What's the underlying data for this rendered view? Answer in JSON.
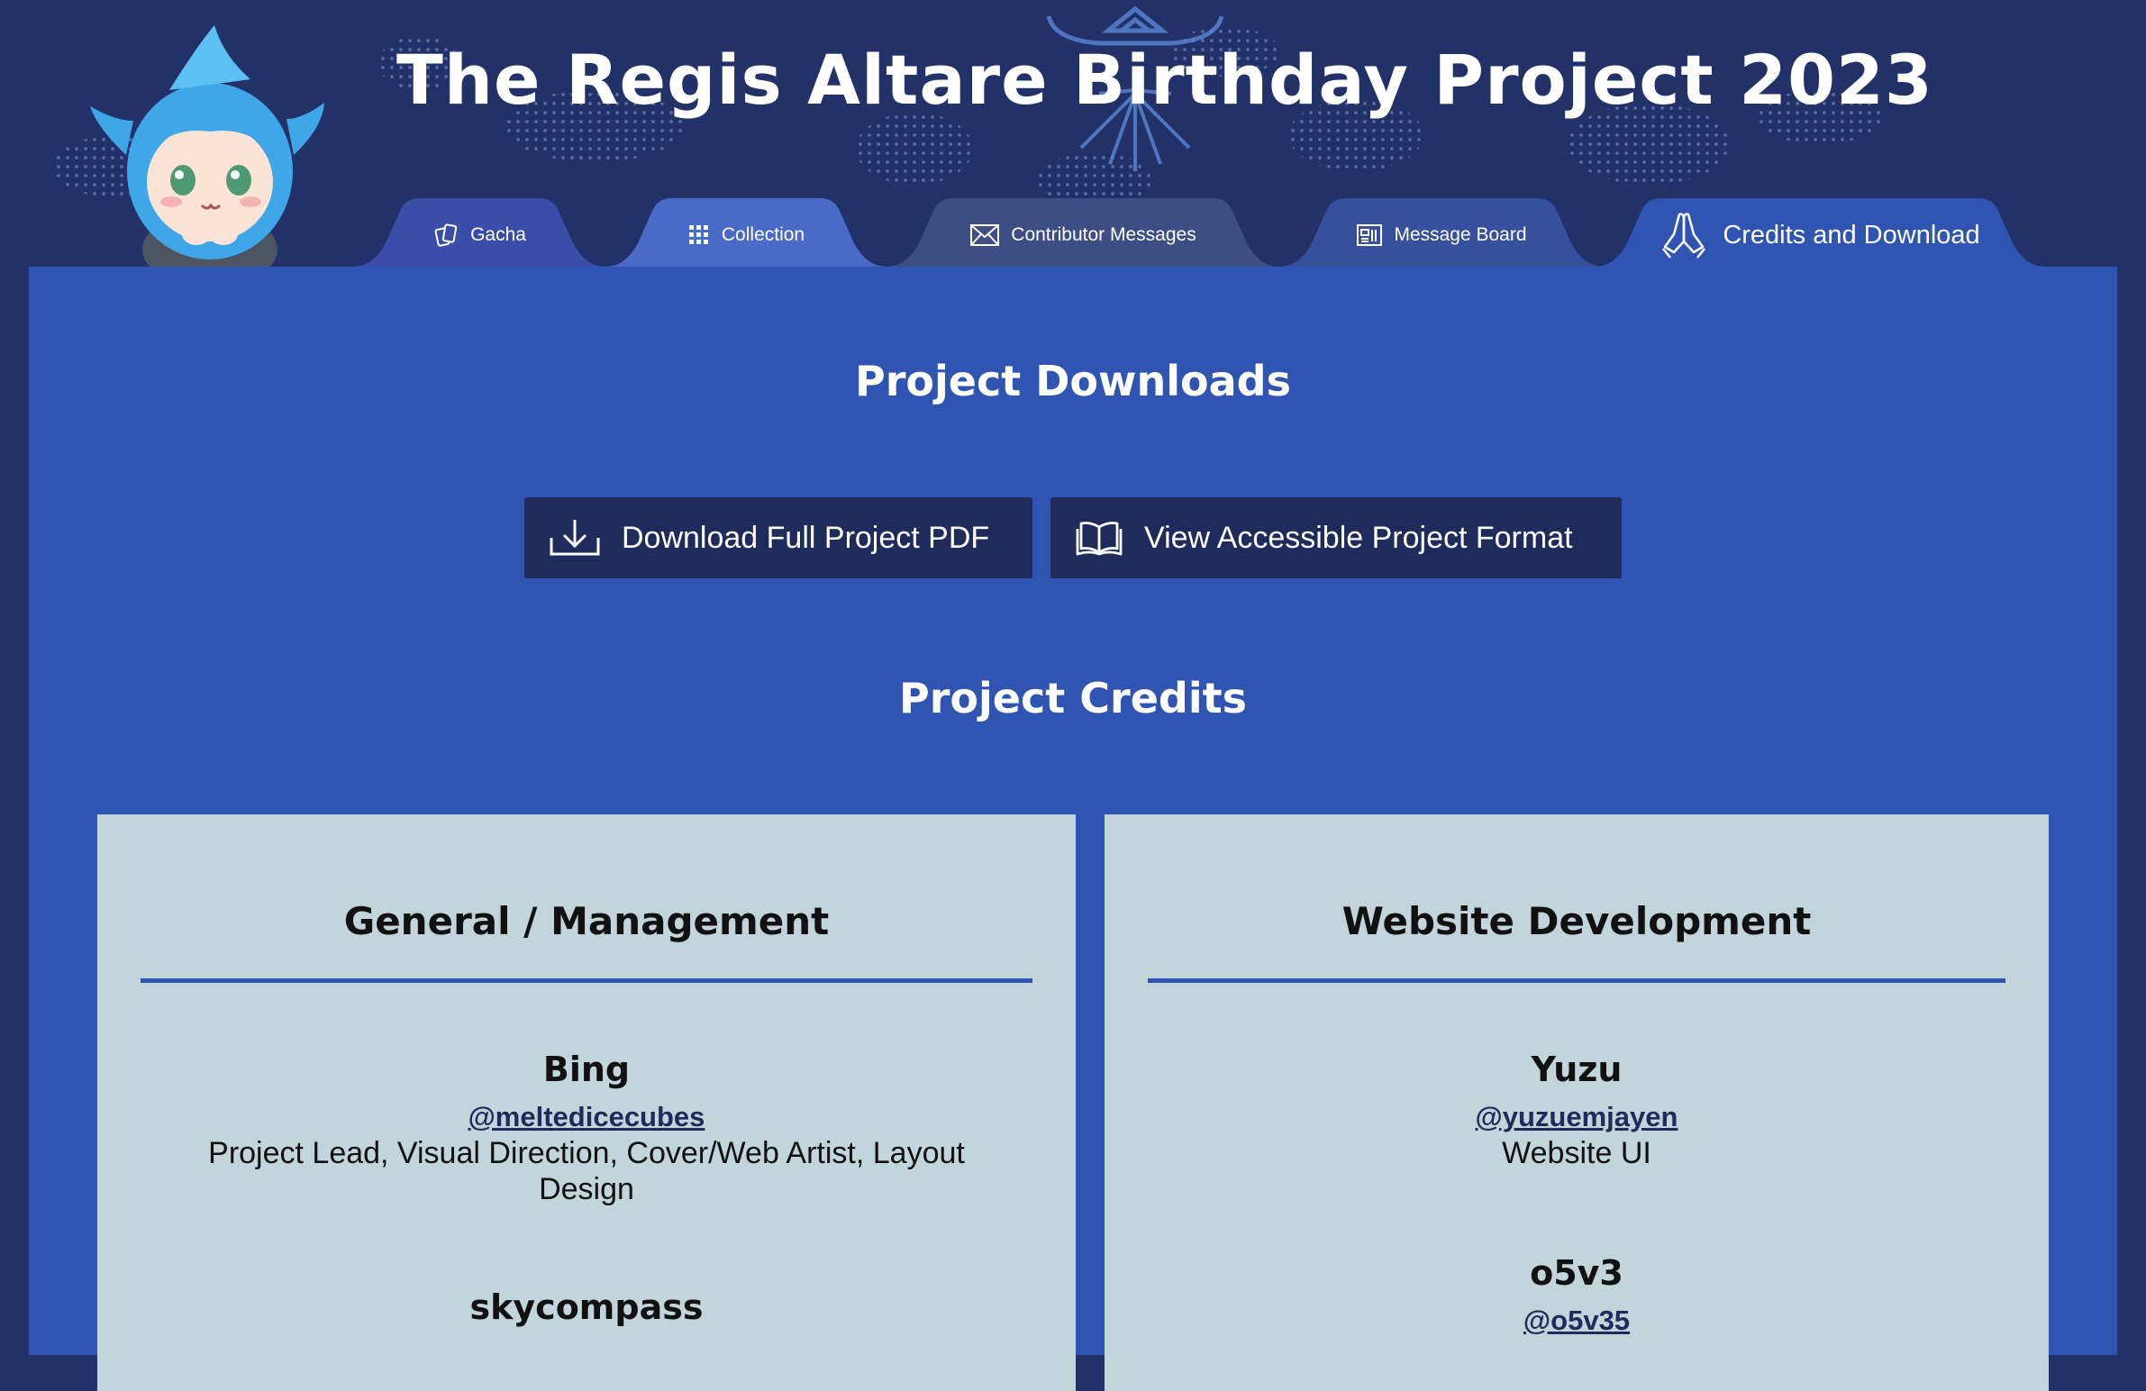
{
  "site": {
    "title": "The Regis Altare Birthday Project 2023"
  },
  "nav": {
    "tabs": [
      {
        "label": "Gacha",
        "icon": "cards-icon"
      },
      {
        "label": "Collection",
        "icon": "grid-icon"
      },
      {
        "label": "Contributor Messages",
        "icon": "envelope-icon"
      },
      {
        "label": "Message Board",
        "icon": "board-icon"
      },
      {
        "label": "Credits and Download",
        "icon": "praying-hands-icon",
        "active": true
      }
    ]
  },
  "downloads": {
    "heading": "Project Downloads",
    "pdf_label": "Download Full Project PDF",
    "accessible_label": "View Accessible Project Format"
  },
  "credits": {
    "heading": "Project Credits",
    "cards": [
      {
        "title": "General / Management",
        "people": [
          {
            "name": "Bing",
            "handle": "@meltedicecubes",
            "role": "Project Lead, Visual Direction, Cover/Web Artist, Layout Design"
          },
          {
            "name": "skycompass"
          }
        ]
      },
      {
        "title": "Website Development",
        "people": [
          {
            "name": "Yuzu",
            "handle": "@yuzuemjayen",
            "role": "Website UI"
          },
          {
            "name": "o5v3",
            "handle": "@o5v35"
          }
        ]
      }
    ]
  },
  "colors": {
    "page_bg": "#223268",
    "content_bg": "#2f54b2",
    "button_bg": "#1e2b5b",
    "card_bg": "#c1d5db",
    "card_rule": "#2f54b2"
  }
}
